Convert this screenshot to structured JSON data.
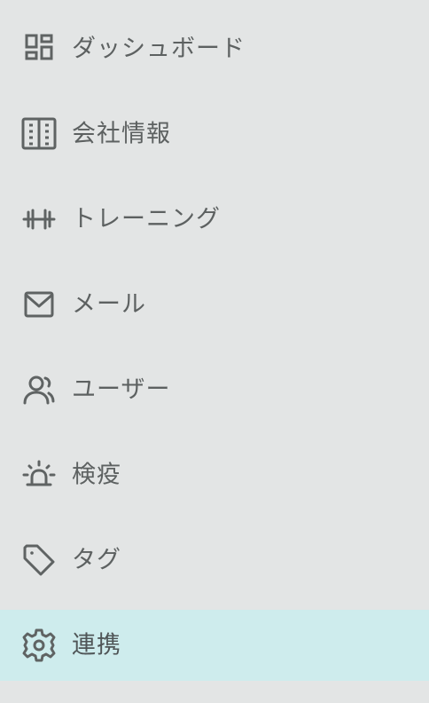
{
  "sidebar": {
    "items": [
      {
        "label": "ダッシュボード",
        "icon": "dashboard-icon"
      },
      {
        "label": "会社情報",
        "icon": "building-icon"
      },
      {
        "label": "トレーニング",
        "icon": "barbell-icon"
      },
      {
        "label": "メール",
        "icon": "mail-icon"
      },
      {
        "label": "ユーザー",
        "icon": "users-icon"
      },
      {
        "label": "検疫",
        "icon": "alarm-light-icon"
      },
      {
        "label": "タグ",
        "icon": "tag-icon"
      },
      {
        "label": "連携",
        "icon": "gear-icon",
        "active": true
      }
    ]
  },
  "colors": {
    "background": "#e3e5e5",
    "active_background": "#ceeced",
    "text": "#5d6161",
    "icon": "#5f6363"
  }
}
